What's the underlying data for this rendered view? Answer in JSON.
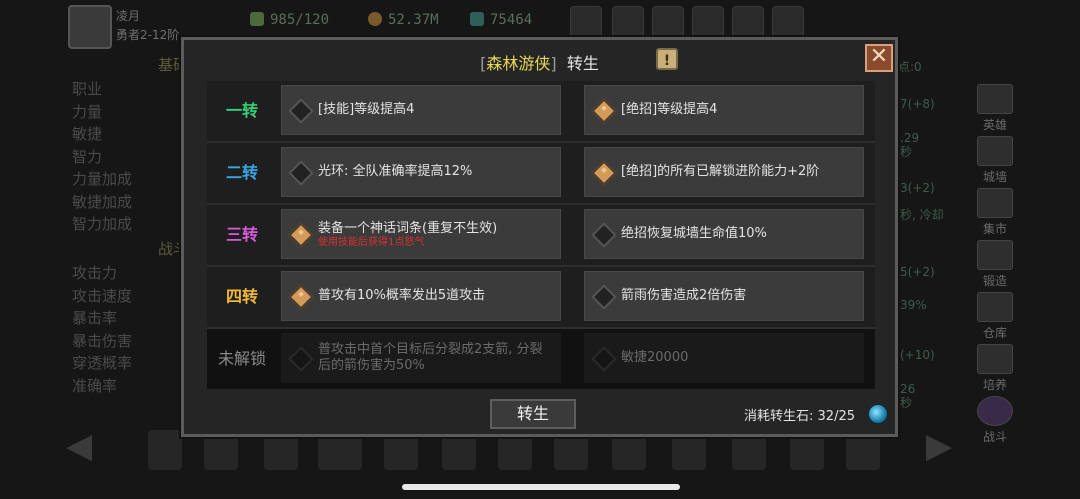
{
  "colors": {
    "tier1": "#36d07a",
    "tier2": "#39a7e6",
    "tier3": "#d75ad8",
    "tier4": "#f2b838",
    "locked": "#8a8a8a",
    "accent": "#e8d65a",
    "danger": "#d83030"
  },
  "player": {
    "name": "凌月",
    "level": "勇者2-12阶"
  },
  "resources": [
    {
      "icon": "energy-icon",
      "value": "985/120"
    },
    {
      "icon": "gold-icon",
      "value": "52.37M"
    },
    {
      "icon": "gem-icon",
      "value": "75464"
    }
  ],
  "bg_left_stats": [
    "职业",
    "力量",
    "敏捷",
    "智力",
    "力量加成",
    "敏捷加成",
    "智力加成"
  ],
  "bg_left_stats2": [
    "攻击力",
    "攻击速度",
    "暴击率",
    "暴击伤害",
    "穿透概率",
    "准确率"
  ],
  "bg_section_base": "基础",
  "bg_section_battle": "战斗",
  "bg_right_frag": [
    "点:0",
    "7(+8)",
    ".29秒",
    "3(+2)",
    "秒, 冷却",
    "5(+2)",
    "39%",
    "(+10)",
    "26秒"
  ],
  "right_nav": [
    {
      "label": "英雄",
      "icon": "hero-icon"
    },
    {
      "label": "城墙",
      "icon": "wall-icon"
    },
    {
      "label": "集市",
      "icon": "market-icon"
    },
    {
      "label": "锻造",
      "icon": "forge-icon"
    },
    {
      "label": "仓库",
      "icon": "warehouse-icon"
    },
    {
      "label": "培养",
      "icon": "train-icon"
    },
    {
      "label": "战斗",
      "icon": "battle-icon"
    }
  ],
  "modal": {
    "bracket_open": "[",
    "class_name": "森林游侠",
    "bracket_close": "]",
    "title": "转生",
    "info_symbol": "!",
    "close_symbol": "✕",
    "rows": [
      {
        "tier": "一转",
        "left": {
          "text": "[技能]等级提高4",
          "sub": "",
          "active": false
        },
        "right": {
          "text": "[绝招]等级提高4",
          "active": true
        }
      },
      {
        "tier": "二转",
        "left": {
          "text": "光环: 全队准确率提高12%",
          "sub": "",
          "active": false
        },
        "right": {
          "text": "[绝招]的所有已解锁进阶能力+2阶",
          "active": true
        }
      },
      {
        "tier": "三转",
        "left": {
          "text": "装备一个神话词条(重复不生效)",
          "sub": "使用技能后获得1点怒气",
          "active": true
        },
        "right": {
          "text": "绝招恢复城墙生命值10%",
          "active": false
        }
      },
      {
        "tier": "四转",
        "left": {
          "text": "普攻有10%概率发出5道攻击",
          "sub": "",
          "active": true
        },
        "right": {
          "text": "箭雨伤害造成2倍伤害",
          "active": false
        }
      },
      {
        "tier": "未解锁",
        "left": {
          "text": "普攻击中首个目标后分裂成2支箭, 分裂后的箭伤害为50%",
          "sub": "",
          "active": false
        },
        "right": {
          "text": "敏捷20000",
          "active": false
        }
      }
    ],
    "reborn_button": "转生",
    "cost_label": "消耗转生石:",
    "cost_value": "32/25"
  }
}
